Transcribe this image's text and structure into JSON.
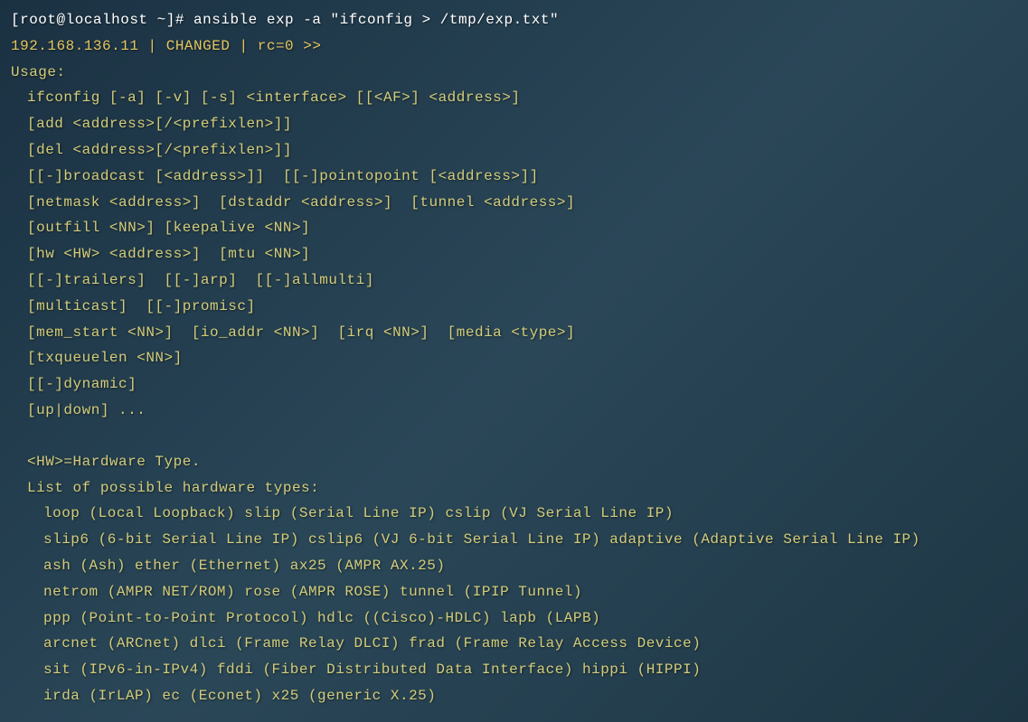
{
  "prompt": {
    "prefix": "[root@localhost ~]# ",
    "command": "ansible exp -a \"ifconfig > /tmp/exp.txt\""
  },
  "status_line": "192.168.136.11 | CHANGED | rc=0 >>",
  "usage_heading": "Usage:",
  "usage_lines": [
    "ifconfig [-a] [-v] [-s] <interface> [[<AF>] <address>]",
    "[add <address>[/<prefixlen>]]",
    "[del <address>[/<prefixlen>]]",
    "[[-]broadcast [<address>]]  [[-]pointopoint [<address>]]",
    "[netmask <address>]  [dstaddr <address>]  [tunnel <address>]",
    "[outfill <NN>] [keepalive <NN>]",
    "[hw <HW> <address>]  [mtu <NN>]",
    "[[-]trailers]  [[-]arp]  [[-]allmulti]",
    "[multicast]  [[-]promisc]",
    "[mem_start <NN>]  [io_addr <NN>]  [irq <NN>]  [media <type>]",
    "[txqueuelen <NN>]",
    "[[-]dynamic]",
    "[up|down] ..."
  ],
  "hw_heading": "<HW>=Hardware Type.",
  "hw_list_heading": "List of possible hardware types:",
  "hw_items": [
    "loop (Local Loopback) slip (Serial Line IP) cslip (VJ Serial Line IP)",
    "slip6 (6-bit Serial Line IP) cslip6 (VJ 6-bit Serial Line IP) adaptive (Adaptive Serial Line IP)",
    "ash (Ash) ether (Ethernet) ax25 (AMPR AX.25)",
    "netrom (AMPR NET/ROM) rose (AMPR ROSE) tunnel (IPIP Tunnel)",
    "ppp (Point-to-Point Protocol) hdlc ((Cisco)-HDLC) lapb (LAPB)",
    "arcnet (ARCnet) dlci (Frame Relay DLCI) frad (Frame Relay Access Device)",
    "sit (IPv6-in-IPv4) fddi (Fiber Distributed Data Interface) hippi (HIPPI)",
    "irda (IrLAP) ec (Econet) x25 (generic X.25)"
  ]
}
